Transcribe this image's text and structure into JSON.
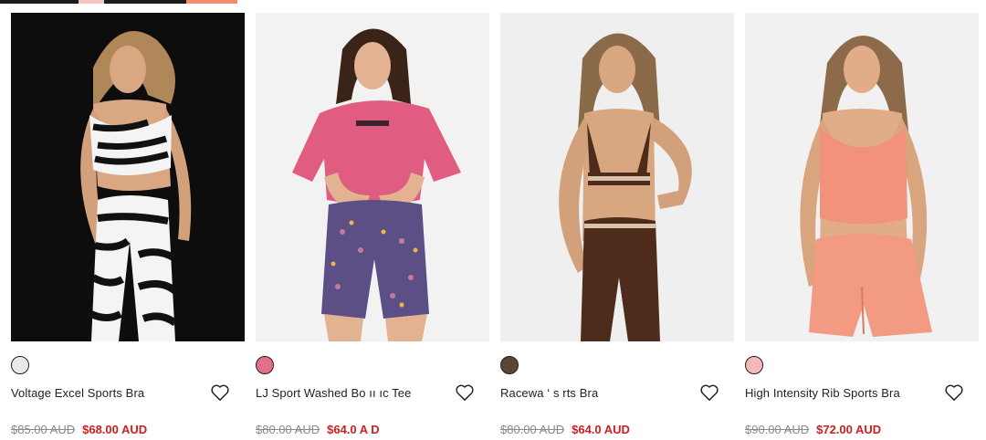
{
  "top_strip_colors": [
    "#1b1b1b",
    "#f3c6c0",
    "#1b1b1b",
    "#ef8e6c"
  ],
  "products": [
    {
      "name": "Voltage Excel Sports Bra",
      "old_price": "$85.00 AUD",
      "sale_price": "$68.00 AUD",
      "swatch_color": "#e9e9e9",
      "image": "model-zebra-print-set"
    },
    {
      "name": "LJ Sport Washed Bo​ ıı​ ıc Tee",
      "old_price": "$80.00 AUD",
      "sale_price": "$64.0​ A​ D",
      "swatch_color": "#e0708a",
      "image": "model-pink-tee-floral-shorts"
    },
    {
      "name": "Racewa​ ‘ s​ rts Bra",
      "old_price": "$80.00 AUD",
      "sale_price": "$64.0 ​AUD",
      "swatch_color": "#5a4639",
      "image": "model-brown-set"
    },
    {
      "name": "High Intensity Rib Sports Bra",
      "old_price": "$90.00 AUD",
      "sale_price": "$72.00 AUD",
      "swatch_color": "#f4b8b8",
      "image": "model-peach-set"
    }
  ]
}
